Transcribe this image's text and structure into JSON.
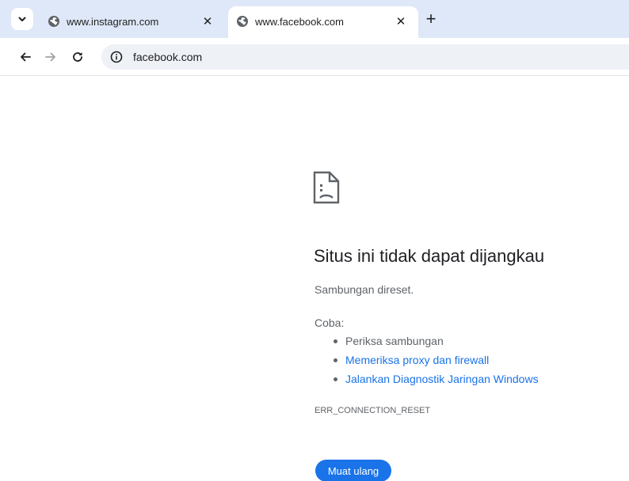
{
  "tabs": [
    {
      "title": "www.instagram.com",
      "icon": "globe-icon",
      "active": false,
      "close_glyph": "✕"
    },
    {
      "title": "www.facebook.com",
      "icon": "globe-icon",
      "active": true,
      "close_glyph": "✕"
    }
  ],
  "new_tab_glyph": "+",
  "toolbar": {
    "url": "facebook.com"
  },
  "error_page": {
    "icon": "sad-document-icon",
    "title": "Situs ini tidak dapat dijangkau",
    "subtitle": "Sambungan direset.",
    "try_label": "Coba:",
    "suggestions": [
      {
        "text": "Periksa sambungan",
        "is_link": false
      },
      {
        "text": "Memeriksa proxy dan firewall",
        "is_link": true
      },
      {
        "text": "Jalankan Diagnostik Jaringan Windows",
        "is_link": true
      }
    ],
    "error_code": "ERR_CONNECTION_RESET",
    "reload_button": "Muat ulang"
  },
  "colors": {
    "tabstrip_bg": "#dfe8f8",
    "omnibox_bg": "#eef1f6",
    "link": "#1a73e8",
    "button": "#1a73e8",
    "text_secondary": "#5f6368"
  }
}
